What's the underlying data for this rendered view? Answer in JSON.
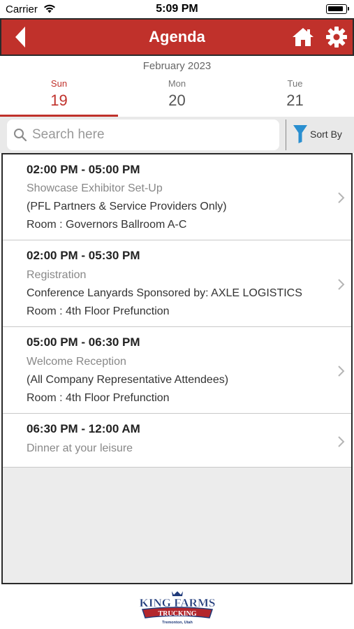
{
  "status_bar": {
    "carrier": "Carrier",
    "time": "5:09 PM"
  },
  "header": {
    "title": "Agenda",
    "back_icon": "back-arrow-icon",
    "home_icon": "home-icon",
    "settings_icon": "gear-icon"
  },
  "calendar": {
    "month": "February 2023",
    "days": [
      {
        "dow": "Sun",
        "num": "19",
        "active": true
      },
      {
        "dow": "Mon",
        "num": "20",
        "active": false
      },
      {
        "dow": "Tue",
        "num": "21",
        "active": false
      }
    ]
  },
  "search": {
    "placeholder": "Search here",
    "value": "",
    "sort_label": "Sort By"
  },
  "agenda": [
    {
      "time": "02:00 PM - 05:00 PM",
      "name": "Showcase Exhibitor Set-Up",
      "desc": "(PFL Partners & Service Providers Only)",
      "room": "Room : Governors Ballroom A-C"
    },
    {
      "time": "02:00 PM - 05:30 PM",
      "name": "Registration",
      "desc": "Conference Lanyards Sponsored by: AXLE LOGISTICS",
      "room": "Room : 4th Floor Prefunction"
    },
    {
      "time": "05:00 PM - 06:30 PM",
      "name": "Welcome Reception",
      "desc": "(All Company Representative Attendees)",
      "room": "Room : 4th Floor Prefunction"
    },
    {
      "time": "06:30 PM - 12:00 AM",
      "name": "Dinner at your leisure"
    }
  ],
  "footer": {
    "logo_line1": "KING FARMS",
    "logo_line2": "TRUCKING",
    "logo_line3": "Tremonton, Utah"
  },
  "colors": {
    "accent": "#c0312b",
    "sort_icon": "#2a8fd0"
  }
}
